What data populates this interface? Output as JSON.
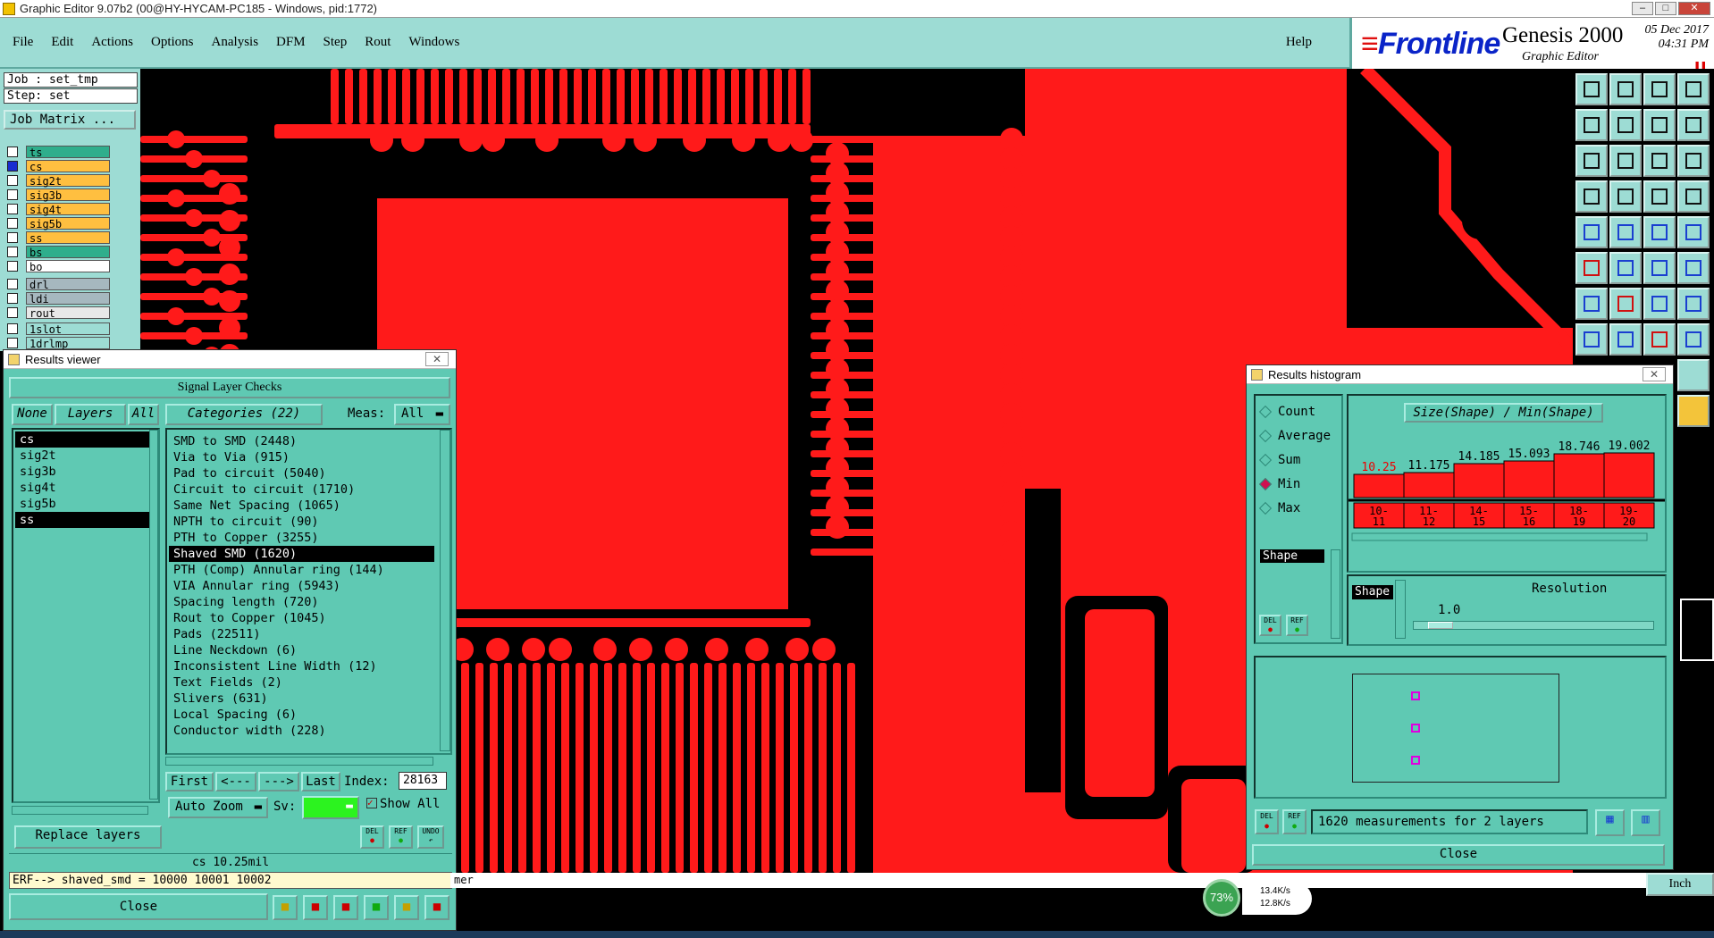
{
  "window": {
    "title": "Graphic Editor 9.07b2 (00@HY-HYCAM-PC185 - Windows, pid:1772)"
  },
  "menu": {
    "items": [
      "File",
      "Edit",
      "Actions",
      "Options",
      "Analysis",
      "DFM",
      "Step",
      "Rout",
      "Windows"
    ],
    "help": "Help"
  },
  "brand": {
    "logo": "Frontline",
    "product": "Genesis 2000",
    "subtitle": "Graphic Editor",
    "date": "05 Dec 2017",
    "time": "04:31 PM"
  },
  "job": {
    "job": "Job : set_tmp",
    "step": "Step: set",
    "matrix_button": "Job Matrix ..."
  },
  "layers": [
    {
      "name": "ts",
      "color": "#2fae8c"
    },
    {
      "name": "cs",
      "color": "#ffbf40"
    },
    {
      "name": "sig2t",
      "color": "#ffbf40"
    },
    {
      "name": "sig3b",
      "color": "#ffbf40"
    },
    {
      "name": "sig4t",
      "color": "#ffbf40"
    },
    {
      "name": "sig5b",
      "color": "#ffbf40"
    },
    {
      "name": "ss",
      "color": "#ffbf40"
    },
    {
      "name": "bs",
      "color": "#2fae8c"
    },
    {
      "name": "bo",
      "color": "#ffffff"
    },
    {
      "name": "drl",
      "color": "#a6b8bf"
    },
    {
      "name": "ldi",
      "color": "#a6b8bf"
    },
    {
      "name": "rout",
      "color": "#e8e8e8"
    },
    {
      "name": "1slot",
      "color": "#9ddcd4"
    },
    {
      "name": "1drlmp",
      "color": "#9ddcd4"
    }
  ],
  "results_viewer": {
    "title": "Results viewer",
    "header": "Signal Layer Checks",
    "none_btn": "None",
    "layers_btn": "Layers",
    "all_btn": "All",
    "categories_btn": "Categories (22)",
    "meas_label": "Meas:",
    "meas_value": "All",
    "layer_list": [
      {
        "name": "cs",
        "selected": true
      },
      {
        "name": "sig2t"
      },
      {
        "name": "sig3b"
      },
      {
        "name": "sig4t"
      },
      {
        "name": "sig5b"
      },
      {
        "name": "ss",
        "selected": true
      }
    ],
    "categories": [
      "SMD to SMD (2448)",
      "Via to Via (915)",
      "Pad to circuit (5040)",
      "Circuit to circuit (1710)",
      "Same Net Spacing (1065)",
      "NPTH to circuit (90)",
      "PTH to Copper (3255)",
      "Shaved SMD (1620)",
      "PTH (Comp) Annular ring (144)",
      "VIA Annular ring (5943)",
      "Spacing length (720)",
      "Rout to Copper (1045)",
      "Pads (22511)",
      "Line Neckdown (6)",
      "Inconsistent Line Width (12)",
      "Text Fields (2)",
      "Slivers (631)",
      "Local Spacing (6)",
      "Conductor width (228)"
    ],
    "selected_category": "Shaved SMD (1620)",
    "first": "First",
    "prev": "<---",
    "next": "--->",
    "last": "Last",
    "index_label": "Index:",
    "index_value": "28163",
    "autozoom": "Auto Zoom",
    "sv_label": "Sv:",
    "show_all": "Show All",
    "del": "DEL",
    "ref": "REF",
    "undo": "UNDO",
    "replace": "Replace layers",
    "measure_line": "cs 10.25mil",
    "erf_line": "ERF--> shaved_smd = 10000 10001 10002",
    "close": "Close"
  },
  "histogram": {
    "title": "Results histogram",
    "options": [
      {
        "label": "Count"
      },
      {
        "label": "Average"
      },
      {
        "label": "Sum"
      },
      {
        "label": "Min",
        "active": true
      },
      {
        "label": "Max"
      }
    ],
    "shape_item": "Shape",
    "chart_title": "Size(Shape) / Min(Shape)",
    "bins": [
      {
        "value": "10.25",
        "range": "10-11",
        "highlight": true
      },
      {
        "value": "11.175",
        "range": "11-12"
      },
      {
        "value": "14.185",
        "range": "14-15"
      },
      {
        "value": "15.093",
        "range": "15-16"
      },
      {
        "value": "18.746",
        "range": "18-19"
      },
      {
        "value": "19.002",
        "range": "19-20"
      }
    ],
    "shape_label": "Shape",
    "resolution_label": "Resolution",
    "resolution_value": "1.0",
    "del": "DEL",
    "ref": "REF",
    "summary": "1620 measurements for 2 layers",
    "close": "Close"
  },
  "status": {
    "bottom_text": "mer",
    "units": "Inch",
    "cpu": "73%",
    "net_up": "13.4K/s",
    "net_down": "12.8K/s"
  }
}
